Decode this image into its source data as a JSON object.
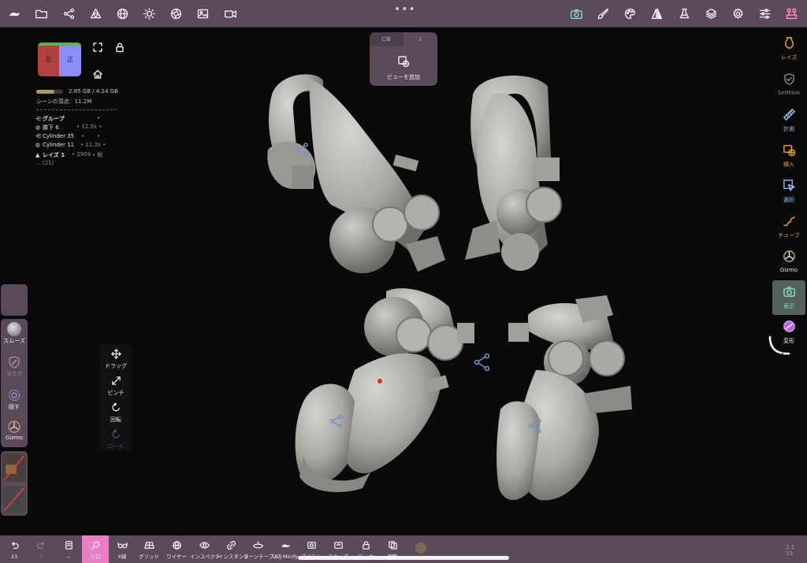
{
  "topbar": {
    "dots": "•••",
    "left_icons": [
      "app-logo-icon",
      "folder-icon",
      "share-icon",
      "mesh-icon",
      "globe-icon",
      "sun-icon",
      "aperture-icon",
      "image-icon",
      "video-icon"
    ],
    "right_icons": [
      "camera-icon",
      "brush-icon",
      "palette-icon",
      "mirror-icon",
      "flask-icon",
      "layers-icon",
      "gear-icon",
      "sliders-icon",
      "hierarchy-icon"
    ]
  },
  "add_view": {
    "tab_left": "C⌘",
    "tab_right": "↓",
    "label": "ビューを追加"
  },
  "navcube": {
    "left_label": "左",
    "front_label": "正"
  },
  "scene": {
    "memory": "2.85 GB / 4.24 GB",
    "memory_fraction": 0.67,
    "vertices": "シーンの頂点：11.2M",
    "tree": [
      {
        "icon": "share-icon",
        "name": "グループ",
        "count": "",
        "extra": "•",
        "group": true
      },
      {
        "icon": "sphere-icon",
        "name": "膝下 6",
        "count": "• 12.5k •",
        "extra": ""
      },
      {
        "icon": "share-icon",
        "name": "Cylinder 35",
        "count": "•",
        "extra": "•"
      },
      {
        "icon": "sphere-icon",
        "name": "Cylinder 11",
        "count": "• 11.2k •",
        "extra": ""
      },
      {
        "icon": "mesh-icon",
        "name": "レイズ 1",
        "count": "• 2904",
        "extra": "• 眼"
      },
      {
        "icon": "",
        "name": "... (21)",
        "count": "",
        "extra": ""
      }
    ]
  },
  "left_tools": {
    "smooth": "スムーズ",
    "mask": "マスク",
    "hide": "隠す",
    "gizmo": "Gizmo"
  },
  "gestures": {
    "drag": "ドラッグ",
    "pinch": "ピンチ",
    "rotate": "回転",
    "roll": "ロール"
  },
  "right_tools": [
    {
      "label": "レイズ",
      "icon": "vase-icon",
      "color": "#f2a53a"
    },
    {
      "label": "SelMask",
      "icon": "shield-icon",
      "color": "#8c8891"
    },
    {
      "label": "計測",
      "icon": "ruler-icon",
      "color": "#9ac4ff"
    },
    {
      "label": "挿入",
      "icon": "insert-icon",
      "color": "#f2a53a"
    },
    {
      "label": "選択",
      "icon": "select-icon",
      "color": "#9ac4ff"
    },
    {
      "label": "チューブ",
      "icon": "tube-icon",
      "color": "#f2a53a"
    },
    {
      "label": "Gizmo",
      "icon": "gizmo-icon",
      "color": "#f0ebf2"
    },
    {
      "label": "表示",
      "icon": "camera-icon",
      "color": "#7fe0c8"
    },
    {
      "label": "変形",
      "icon": "deform-icon",
      "color": "#c98cff"
    }
  ],
  "bottombar": {
    "undo": "23",
    "redo": "0",
    "history": "--",
    "solo": "ソロ",
    "xray": "X線",
    "grid": "グリッド",
    "wire": "ワイヤー",
    "inspector": "インスペクタ",
    "instance": "インスタンス",
    "turntable": "ターンテーブル",
    "minify": "UIをMinify",
    "b12": "アイテム",
    "b13": "スナップ",
    "b14": "ロック",
    "b15": "複製"
  },
  "corner": {
    "line1": "2.1",
    "line2": "15"
  }
}
